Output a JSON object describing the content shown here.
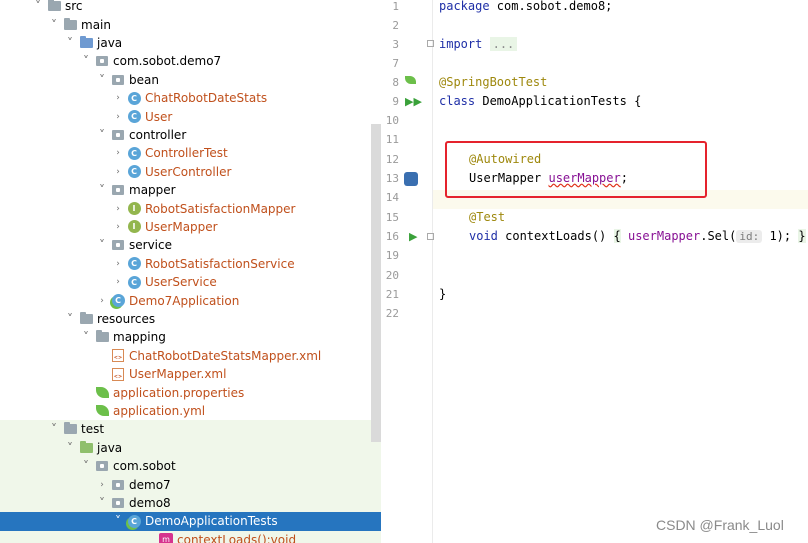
{
  "tree": {
    "rows": [
      {
        "label": "src",
        "chev": "˅",
        "icon": "folder",
        "indent": 32,
        "color": "default"
      },
      {
        "label": "main",
        "chev": "˅",
        "icon": "folder",
        "indent": 48,
        "color": "default"
      },
      {
        "label": "java",
        "chev": "˅",
        "icon": "folder-src",
        "indent": 64,
        "color": "default"
      },
      {
        "label": "com.sobot.demo7",
        "chev": "˅",
        "icon": "package",
        "indent": 80,
        "color": "default"
      },
      {
        "label": "bean",
        "chev": "˅",
        "icon": "package",
        "indent": 96,
        "color": "default"
      },
      {
        "label": "ChatRobotDateStats",
        "chev": "›",
        "icon": "class",
        "indent": 112,
        "color": "orange"
      },
      {
        "label": "User",
        "chev": "›",
        "icon": "class",
        "indent": 112,
        "color": "orange"
      },
      {
        "label": "controller",
        "chev": "˅",
        "icon": "package",
        "indent": 96,
        "color": "default"
      },
      {
        "label": "ControllerTest",
        "chev": "›",
        "icon": "class",
        "indent": 112,
        "color": "orange"
      },
      {
        "label": "UserController",
        "chev": "›",
        "icon": "class",
        "indent": 112,
        "color": "orange"
      },
      {
        "label": "mapper",
        "chev": "˅",
        "icon": "package",
        "indent": 96,
        "color": "default"
      },
      {
        "label": "RobotSatisfactionMapper",
        "chev": "›",
        "icon": "interface",
        "indent": 112,
        "color": "orange"
      },
      {
        "label": "UserMapper",
        "chev": "›",
        "icon": "interface",
        "indent": 112,
        "color": "orange"
      },
      {
        "label": "service",
        "chev": "˅",
        "icon": "package",
        "indent": 96,
        "color": "default"
      },
      {
        "label": "RobotSatisfactionService",
        "chev": "›",
        "icon": "class",
        "indent": 112,
        "color": "orange"
      },
      {
        "label": "UserService",
        "chev": "›",
        "icon": "class",
        "indent": 112,
        "color": "orange"
      },
      {
        "label": "Demo7Application",
        "chev": "›",
        "icon": "boot-class",
        "indent": 96,
        "color": "orange"
      },
      {
        "label": "resources",
        "chev": "˅",
        "icon": "folder-res",
        "indent": 64,
        "color": "default"
      },
      {
        "label": "mapping",
        "chev": "˅",
        "icon": "folder",
        "indent": 80,
        "color": "default"
      },
      {
        "label": "ChatRobotDateStatsMapper.xml",
        "chev": "",
        "icon": "xml",
        "indent": 96,
        "color": "orange"
      },
      {
        "label": "UserMapper.xml",
        "chev": "",
        "icon": "xml",
        "indent": 96,
        "color": "orange"
      },
      {
        "label": "application.properties",
        "chev": "",
        "icon": "leaf",
        "indent": 80,
        "color": "orange"
      },
      {
        "label": "application.yml",
        "chev": "",
        "icon": "leaf",
        "indent": 80,
        "color": "orange"
      },
      {
        "label": "test",
        "chev": "˅",
        "icon": "folder",
        "indent": 48,
        "color": "default",
        "alt": true
      },
      {
        "label": "java",
        "chev": "˅",
        "icon": "folder-test",
        "indent": 64,
        "color": "default",
        "alt": true
      },
      {
        "label": "com.sobot",
        "chev": "˅",
        "icon": "package",
        "indent": 80,
        "color": "default",
        "alt": true
      },
      {
        "label": "demo7",
        "chev": "›",
        "icon": "package",
        "indent": 96,
        "color": "default",
        "alt": true
      },
      {
        "label": "demo8",
        "chev": "˅",
        "icon": "package",
        "indent": 96,
        "color": "default",
        "alt": true
      },
      {
        "label": "DemoApplicationTests",
        "chev": "˅",
        "icon": "boot-class",
        "indent": 112,
        "color": "default",
        "selected": true
      },
      {
        "label": "contextLoads():void",
        "chev": "",
        "icon": "method",
        "indent": 144,
        "color": "orange",
        "alt": true
      }
    ]
  },
  "editor": {
    "line_numbers": [
      "1",
      "2",
      "3",
      "7",
      "8",
      "9",
      "10",
      "11",
      "12",
      "13",
      "14",
      "15",
      "16",
      "19",
      "20",
      "21",
      "22"
    ],
    "code": {
      "l1_kw": "package",
      "l1_rest": " com.sobot.demo8;",
      "l3_kw": "import",
      "l3_fold": "...",
      "l8_ann": "@SpringBootTest",
      "l9_kw": "class",
      "l9_rest": " DemoApplicationTests {",
      "l12_ann": "@Autowired",
      "l13_type": "UserMapper ",
      "l13_field": "userMapper",
      "l13_semi": ";",
      "l15_ann": "@Test",
      "l16_kw": "void",
      "l16_name": " contextLoads() ",
      "l16_open": "{",
      "l16_field": "userMapper",
      "l16_call": ".Sel(",
      "l16_hint": "id:",
      "l16_arg": " 1); ",
      "l16_close": "}",
      "l21_close": "}"
    }
  },
  "watermark": "CSDN @Frank_Luol"
}
